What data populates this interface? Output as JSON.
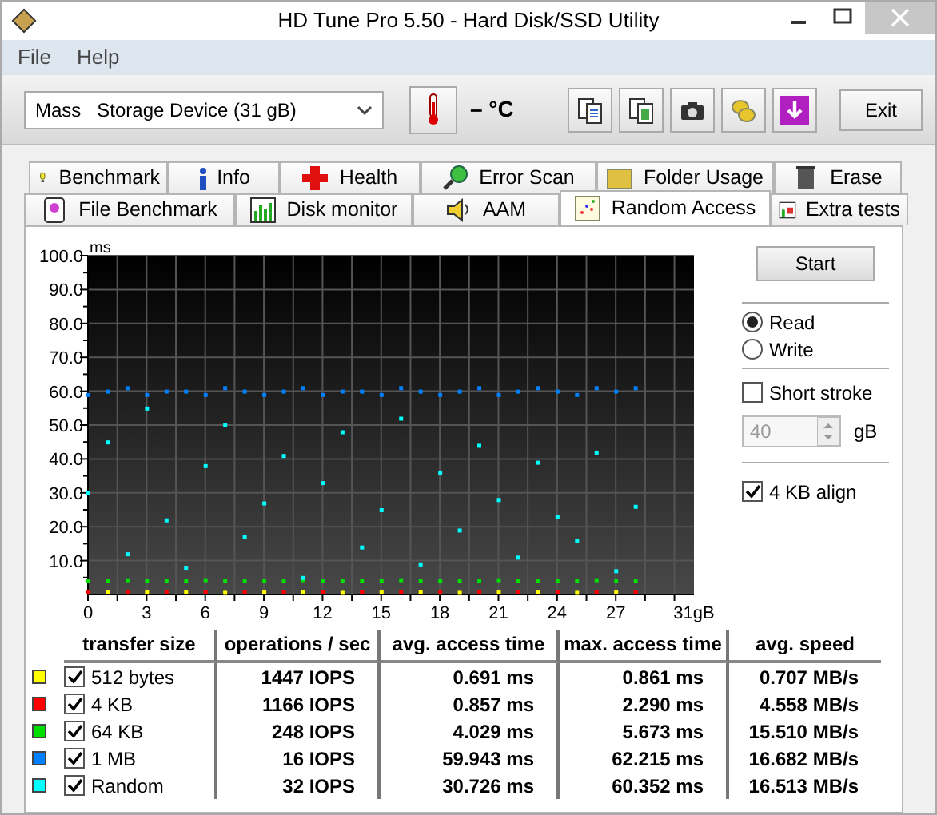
{
  "window": {
    "title": "HD Tune Pro 5.50 - Hard Disk/SSD Utility"
  },
  "menu": [
    {
      "label": "File"
    },
    {
      "label": "Help"
    }
  ],
  "toolbar": {
    "device": "Mass   Storage Device (31 gB)",
    "temperature": "– °C",
    "exit": "Exit"
  },
  "tabs": [
    [
      {
        "label": "Benchmark",
        "selected": false
      },
      {
        "label": "Info",
        "selected": false
      },
      {
        "label": "Health",
        "selected": false
      },
      {
        "label": "Error Scan",
        "selected": false
      },
      {
        "label": "Folder Usage",
        "selected": false
      },
      {
        "label": "Erase",
        "selected": false
      }
    ],
    [
      {
        "label": "File Benchmark",
        "selected": false
      },
      {
        "label": "Disk monitor",
        "selected": false
      },
      {
        "label": "AAM",
        "selected": false
      },
      {
        "label": "Random Access",
        "selected": true
      },
      {
        "label": "Extra tests",
        "selected": false
      }
    ]
  ],
  "chart_data": {
    "type": "scatter",
    "grid": true,
    "ylabel": "ms",
    "xlim": [
      0,
      31
    ],
    "ylim": [
      0,
      100
    ],
    "xticks": [
      0,
      3,
      6,
      9,
      12,
      15,
      18,
      21,
      24,
      27,
      {
        "value": 31,
        "label": "31gB"
      }
    ],
    "yticks": [
      {
        "value": 10,
        "label": "10.0"
      },
      {
        "value": 20,
        "label": "20.0"
      },
      {
        "value": 30,
        "label": "30.0"
      },
      {
        "value": 40,
        "label": "40.0"
      },
      {
        "value": 50,
        "label": "50.0"
      },
      {
        "value": 60,
        "label": "60.0"
      },
      {
        "value": 70,
        "label": "70.0"
      },
      {
        "value": 80,
        "label": "80.0"
      },
      {
        "value": 90,
        "label": "90.0"
      },
      {
        "value": 100,
        "label": "100.0"
      }
    ],
    "x": [
      0,
      1,
      2,
      3,
      4,
      5,
      6,
      7,
      8,
      9,
      10,
      11,
      12,
      13,
      14,
      15,
      16,
      17,
      18,
      19,
      20,
      21,
      22,
      23,
      24,
      25,
      26,
      27,
      28
    ],
    "series": [
      {
        "color": "#ffff00",
        "values": [
          null,
          0.7,
          null,
          0.7,
          null,
          0.7,
          null,
          0.6,
          null,
          0.7,
          null,
          0.7,
          null,
          0.6,
          null,
          0.7,
          null,
          0.7,
          null,
          0.6,
          null,
          0.7,
          null,
          0.7,
          null,
          0.6,
          null,
          0.7,
          null
        ]
      },
      {
        "color": "#ff0000",
        "values": [
          0.9,
          null,
          0.9,
          null,
          0.9,
          null,
          0.9,
          null,
          0.9,
          null,
          0.9,
          null,
          0.9,
          null,
          0.9,
          null,
          0.9,
          null,
          0.9,
          null,
          0.9,
          null,
          0.9,
          null,
          0.9,
          null,
          0.9,
          null,
          0.9
        ]
      },
      {
        "color": "#00e000",
        "values": [
          4.0,
          4.0,
          4.1,
          4.0,
          4.0,
          4.0,
          4.1,
          4.0,
          4.0,
          4.0,
          4.0,
          4.1,
          4.0,
          4.0,
          4.0,
          4.0,
          4.1,
          4.0,
          4.0,
          4.0,
          4.0,
          4.1,
          4.0,
          4.0,
          4.0,
          4.0,
          4.1,
          4.0,
          4.0
        ]
      },
      {
        "color": "#0080ff",
        "values": [
          59,
          60,
          61,
          59,
          60,
          60,
          59,
          61,
          60,
          59,
          60,
          61,
          59,
          60,
          60,
          59,
          61,
          60,
          59,
          60,
          61,
          59,
          60,
          61,
          60,
          59,
          61,
          60,
          61
        ]
      },
      {
        "color": "#00ffff",
        "values": [
          30,
          45,
          12,
          55,
          22,
          8,
          38,
          50,
          17,
          27,
          41,
          5,
          33,
          48,
          14,
          25,
          52,
          9,
          36,
          19,
          44,
          28,
          11,
          39,
          23,
          16,
          42,
          7,
          26
        ]
      }
    ]
  },
  "controls": {
    "start": "Start",
    "modes": [
      {
        "label": "Read",
        "selected": true
      },
      {
        "label": "Write",
        "selected": false
      }
    ],
    "short_stroke": {
      "label": "Short stroke",
      "checked": false,
      "value": "40",
      "disabled": true,
      "unit": "gB"
    },
    "align": {
      "label": "4 KB align",
      "checked": true
    }
  },
  "table": {
    "columns": [
      "transfer size",
      "operations / sec",
      "avg. access time",
      "max. access time",
      "avg. speed"
    ],
    "rows": [
      {
        "color": "#ffff00",
        "checked": true,
        "cells": [
          "512 bytes",
          "1447 IOPS",
          "0.691 ms",
          "0.861 ms",
          "0.707 MB/s"
        ]
      },
      {
        "color": "#ff0000",
        "checked": true,
        "cells": [
          "4 KB",
          "1166 IOPS",
          "0.857 ms",
          "2.290 ms",
          "4.558 MB/s"
        ]
      },
      {
        "color": "#00e000",
        "checked": true,
        "cells": [
          "64 KB",
          "248 IOPS",
          "4.029 ms",
          "5.673 ms",
          "15.510 MB/s"
        ]
      },
      {
        "color": "#0080ff",
        "checked": true,
        "cells": [
          "1 MB",
          "16 IOPS",
          "59.943 ms",
          "62.215 ms",
          "16.682 MB/s"
        ]
      },
      {
        "color": "#00ffff",
        "checked": true,
        "cells": [
          "Random",
          "32 IOPS",
          "30.726 ms",
          "60.352 ms",
          "16.513 MB/s"
        ]
      }
    ]
  }
}
